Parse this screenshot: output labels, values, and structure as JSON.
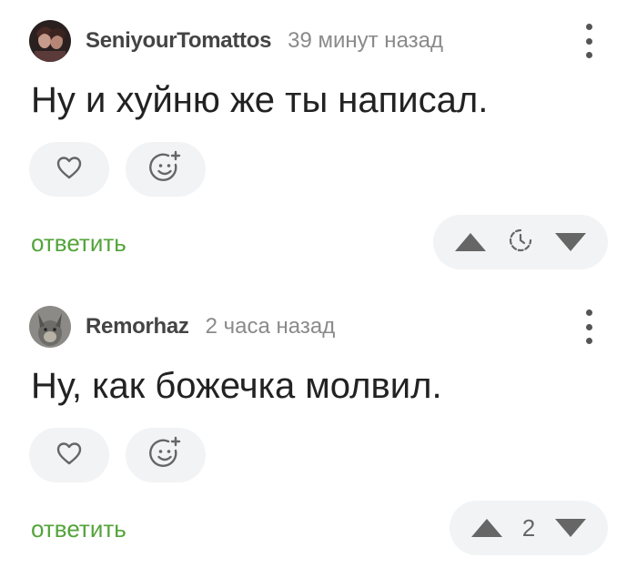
{
  "comments": [
    {
      "username": "SeniyourTomattos",
      "time": "39 минут назад",
      "text": "Ну и хуйню же ты написал.",
      "reply_label": "ответить",
      "rating": null,
      "rating_icon": "pending-clock-icon"
    },
    {
      "username": "Remorhaz",
      "time": "2 часа назад",
      "text": "Ну, как божечка молвил.",
      "reply_label": "ответить",
      "rating": "2"
    }
  ],
  "colors": {
    "reply_link": "#53a43a",
    "pill_bg": "#f2f3f5",
    "icon": "#666666"
  }
}
